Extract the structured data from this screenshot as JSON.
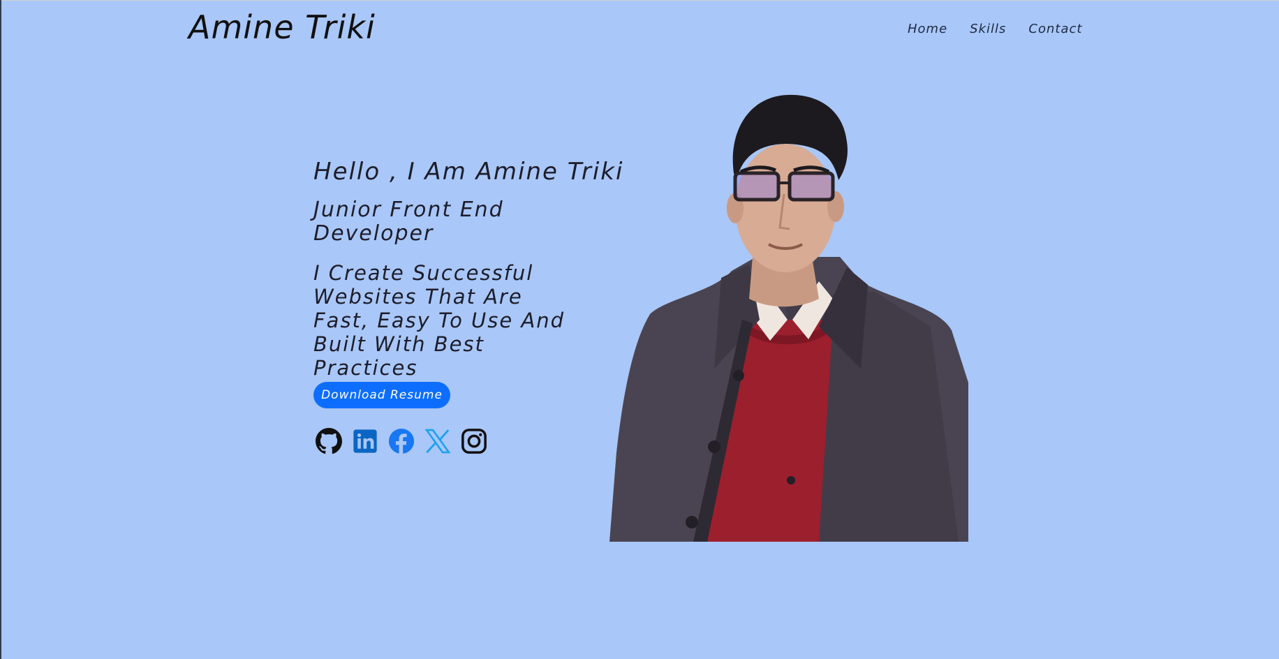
{
  "header": {
    "brand": "Amine Triki",
    "nav": [
      {
        "label": "Home"
      },
      {
        "label": "Skills"
      },
      {
        "label": "Contact"
      }
    ]
  },
  "hero": {
    "greeting": "Hello , I Am Amine Triki",
    "role": "Junior Front End Developer",
    "pitch": "I Create Successful Websites That Are Fast, Easy To Use And Built With Best Practices",
    "resume_button": "Download Resume",
    "socials": [
      {
        "icon": "github-icon",
        "color": "#111111"
      },
      {
        "icon": "linkedin-icon",
        "color": "#0a66c2"
      },
      {
        "icon": "facebook-icon",
        "color": "#1877f2"
      },
      {
        "icon": "x-twitter-icon",
        "color": "#1da1f2"
      },
      {
        "icon": "instagram-icon",
        "color": "#111111"
      }
    ]
  },
  "colors": {
    "background": "#a9c7f8",
    "accent": "#0d6efd"
  }
}
